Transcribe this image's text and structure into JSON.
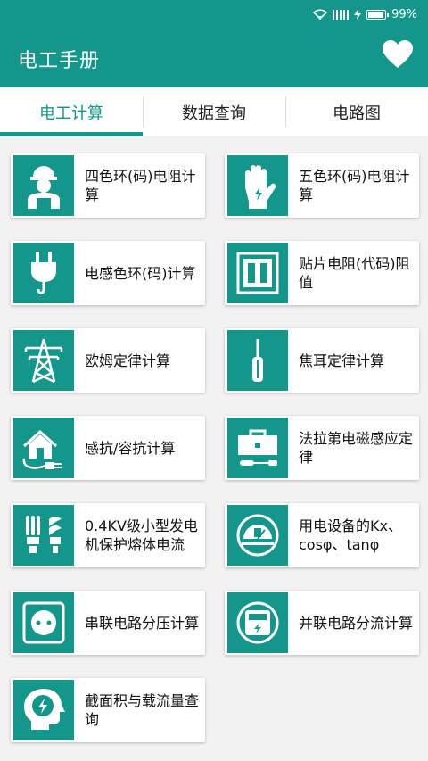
{
  "status": {
    "battery": "99%"
  },
  "appbar": {
    "title": "电工手册",
    "favorite_icon": "heart-icon"
  },
  "tabs": [
    {
      "label": "电工计算",
      "active": true
    },
    {
      "label": "数据查询",
      "active": false
    },
    {
      "label": "电路图",
      "active": false
    }
  ],
  "colors": {
    "primary": "#15968a",
    "background": "#f2f2f2"
  },
  "items": [
    {
      "label": "四色环(码)电阻计算",
      "icon": "worker-icon"
    },
    {
      "label": "五色环(码)电阻计算",
      "icon": "glove-icon"
    },
    {
      "label": "电感色环(码)计算",
      "icon": "plug-icon"
    },
    {
      "label": "贴片电阻(代码)阻值",
      "icon": "switch-icon"
    },
    {
      "label": "欧姆定律计算",
      "icon": "tower-icon"
    },
    {
      "label": "焦耳定律计算",
      "icon": "screwdriver-icon"
    },
    {
      "label": "感抗/容抗计算",
      "icon": "house-plug-icon"
    },
    {
      "label": "法拉第电磁感应定律",
      "icon": "toolbox-icon"
    },
    {
      "label": "0.4KV级小型发电机保护熔体电流",
      "icon": "bulb-icon"
    },
    {
      "label": "用电设备的Kx、cosφ、tanφ",
      "icon": "meter-icon"
    },
    {
      "label": "串联电路分压计算",
      "icon": "socket-icon"
    },
    {
      "label": "并联电路分流计算",
      "icon": "electric-meter-icon"
    },
    {
      "label": "截面积与载流量查询",
      "icon": "head-bolt-icon"
    }
  ]
}
